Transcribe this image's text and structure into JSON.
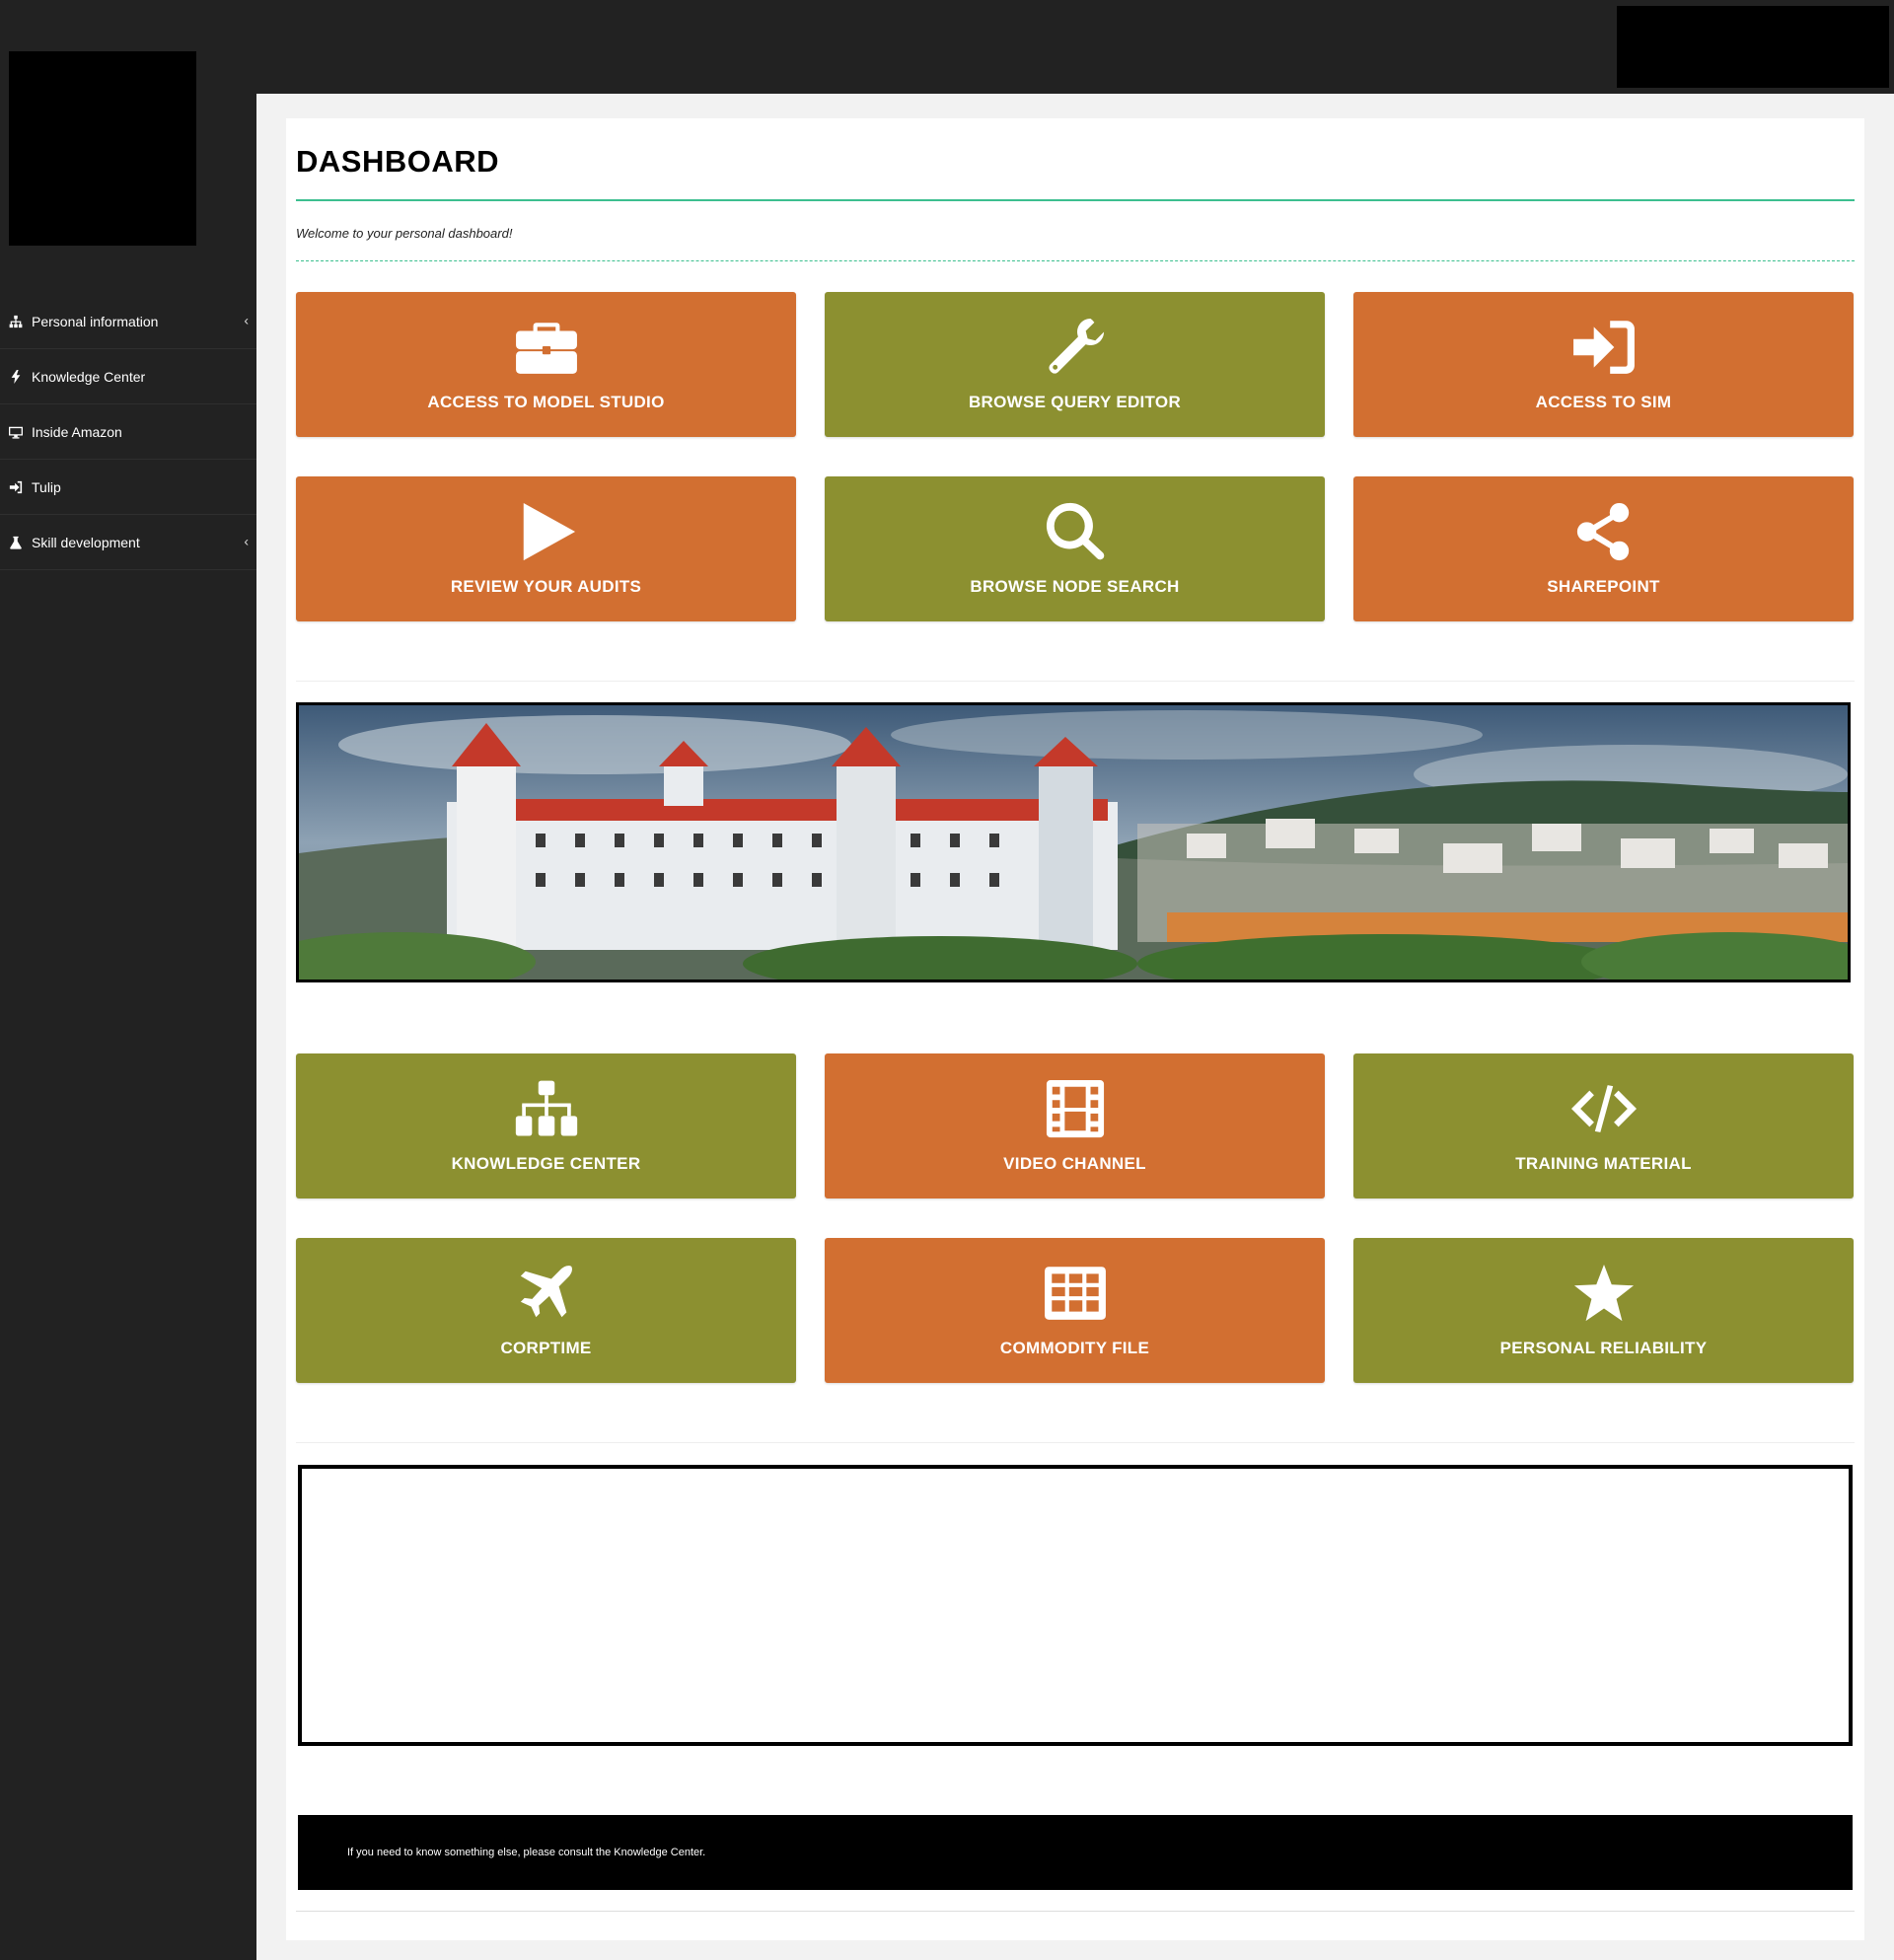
{
  "sidebar": {
    "items": [
      {
        "label": "Personal information",
        "icon": "sitemap-icon",
        "has_submenu": true
      },
      {
        "label": "Knowledge Center",
        "icon": "bolt-icon",
        "has_submenu": false
      },
      {
        "label": "Inside Amazon",
        "icon": "desktop-icon",
        "has_submenu": false
      },
      {
        "label": "Tulip",
        "icon": "sign-in-icon",
        "has_submenu": false
      },
      {
        "label": "Skill development",
        "icon": "flask-icon",
        "has_submenu": true
      }
    ],
    "chevron": "‹"
  },
  "main": {
    "title": "DASHBOARD",
    "welcome": "Welcome to your personal dashboard!",
    "tiles_top": [
      {
        "label": "ACCESS TO MODEL STUDIO",
        "icon": "briefcase-icon",
        "color": "#d26f31"
      },
      {
        "label": "BROWSE QUERY EDITOR",
        "icon": "wrench-icon",
        "color": "#8c9030"
      },
      {
        "label": "ACCESS TO SIM",
        "icon": "sign-in-icon",
        "color": "#d26f31"
      },
      {
        "label": "REVIEW YOUR AUDITS",
        "icon": "play-icon",
        "color": "#d26f31"
      },
      {
        "label": "BROWSE NODE SEARCH",
        "icon": "search-icon",
        "color": "#8c9030"
      },
      {
        "label": "SHAREPOINT",
        "icon": "share-icon",
        "color": "#d26f31"
      }
    ],
    "tiles_bottom": [
      {
        "label": "KNOWLEDGE CENTER",
        "icon": "sitemap-icon",
        "color": "#8c9030"
      },
      {
        "label": "VIDEO CHANNEL",
        "icon": "film-icon",
        "color": "#d26f31"
      },
      {
        "label": "TRAINING MATERIAL",
        "icon": "code-icon",
        "color": "#8c9030"
      },
      {
        "label": "CORPTIME",
        "icon": "plane-icon",
        "color": "#8c9030"
      },
      {
        "label": "COMMODITY FILE",
        "icon": "table-icon",
        "color": "#d26f31"
      },
      {
        "label": "PERSONAL RELIABILITY",
        "icon": "star-icon",
        "color": "#8c9030"
      }
    ],
    "footer_text": "If you need to know something else, please consult the Knowledge Center."
  },
  "colors": {
    "accent_line": "#3cbf8f",
    "orange": "#d26f31",
    "olive": "#8c9030"
  }
}
